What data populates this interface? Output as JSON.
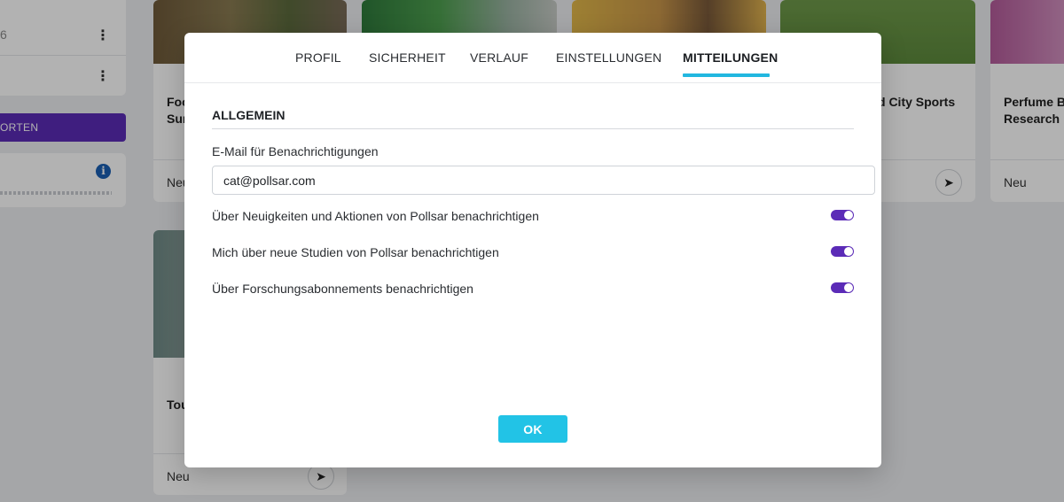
{
  "background": {
    "left_panel": {
      "row_number": "6",
      "kebab_glyph": "⋮",
      "purple_button_label": "ORTEN",
      "info_glyph": "i"
    },
    "cards": [
      {
        "title": "Foo\nSur",
        "status": "Neu"
      },
      {
        "title": "",
        "status": ""
      },
      {
        "title": "",
        "status": ""
      },
      {
        "title": "d City Sports",
        "status": ""
      },
      {
        "title": "Perfume Br\nResearch",
        "status": "Neu"
      },
      {
        "title": "Tou",
        "status": "Neu"
      }
    ],
    "send_glyph": "➤"
  },
  "modal": {
    "tabs": [
      {
        "label": "PROFIL",
        "active": false
      },
      {
        "label": "SICHERHEIT",
        "active": false
      },
      {
        "label": "VERLAUF",
        "active": false
      },
      {
        "label": "EINSTELLUNGEN",
        "active": false
      },
      {
        "label": "MITTEILUNGEN",
        "active": true
      }
    ],
    "section_title": "ALLGEMEIN",
    "email_label": "E-Mail für Benachrichtigungen",
    "email_value": "cat@pollsar.com",
    "toggles": [
      {
        "label": "Über Neuigkeiten und Aktionen von Pollsar benachrichtigen",
        "on": true
      },
      {
        "label": "Mich über neue Studien von Pollsar benachrichtigen",
        "on": true
      },
      {
        "label": "Über Forschungsabonnements benachrichtigen",
        "on": true
      }
    ],
    "ok_label": "OK"
  },
  "colors": {
    "accent": "#22b7e0",
    "toggle_on": "#5b2bb7",
    "purple_button": "#5b2bb7"
  }
}
